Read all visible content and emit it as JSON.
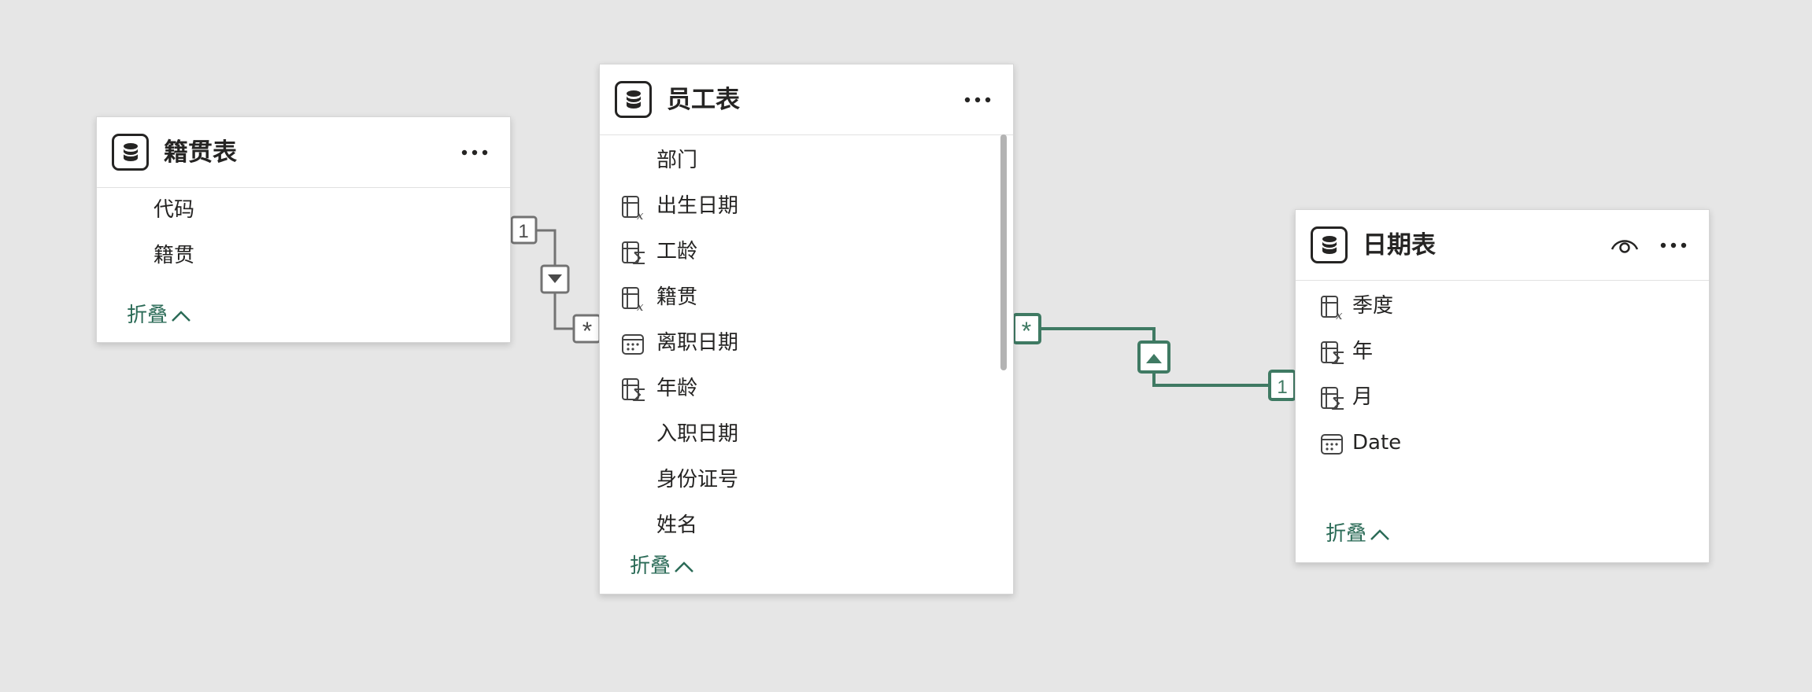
{
  "colors": {
    "canvas_bg": "#e6e6e6",
    "card_bg": "#ffffff",
    "accent_green": "#2b6b57",
    "relationship_grey": "#737373",
    "relationship_active": "#3f7a63"
  },
  "tables": {
    "jiguan": {
      "title": "籍贯表",
      "icon": "table-icon",
      "fields": [
        {
          "label": "代码",
          "icon": ""
        },
        {
          "label": "籍贯",
          "icon": ""
        }
      ],
      "collapse_label": "折叠"
    },
    "yuangong": {
      "title": "员工表",
      "icon": "table-icon",
      "fields": [
        {
          "label": "部门",
          "icon": ""
        },
        {
          "label": "出生日期",
          "icon": "calculated-column-icon"
        },
        {
          "label": "工龄",
          "icon": "calculated-measure-icon"
        },
        {
          "label": "籍贯",
          "icon": "calculated-column-icon"
        },
        {
          "label": "离职日期",
          "icon": "calendar-icon"
        },
        {
          "label": "年龄",
          "icon": "calculated-measure-icon"
        },
        {
          "label": "入职日期",
          "icon": ""
        },
        {
          "label": "身份证号",
          "icon": ""
        },
        {
          "label": "姓名",
          "icon": ""
        }
      ],
      "collapse_label": "折叠"
    },
    "riqi": {
      "title": "日期表",
      "icon": "table-icon",
      "fields": [
        {
          "label": "季度",
          "icon": "calculated-column-icon"
        },
        {
          "label": "年",
          "icon": "calculated-measure-icon"
        },
        {
          "label": "月",
          "icon": "calculated-measure-icon"
        },
        {
          "label": "Date",
          "icon": "calendar-icon"
        }
      ],
      "collapse_label": "折叠"
    }
  },
  "relationships": [
    {
      "from_table": "籍贯表",
      "to_table": "员工表",
      "one_marker": "1",
      "many_marker": "*",
      "filter_direction": "down-arrow",
      "active": false
    },
    {
      "from_table": "员工表",
      "to_table": "日期表",
      "many_marker": "*",
      "one_marker": "1",
      "filter_direction": "up-arrow",
      "active": true
    }
  ]
}
